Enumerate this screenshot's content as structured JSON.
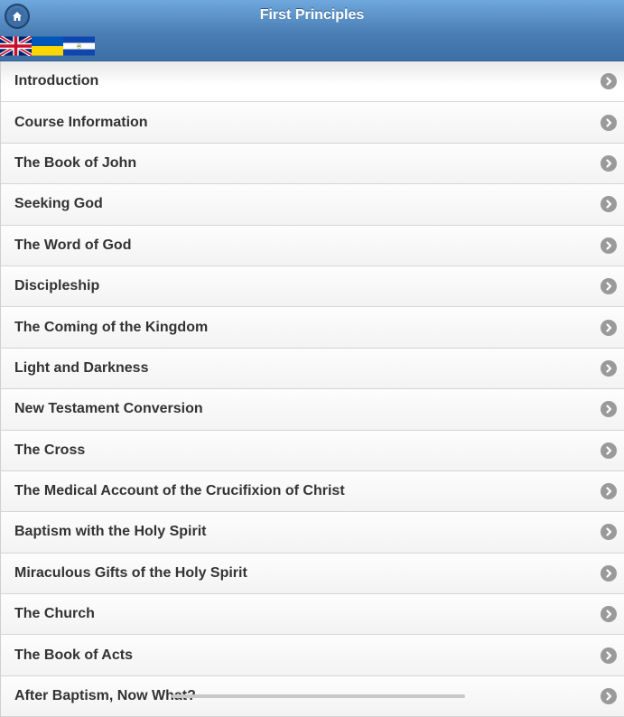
{
  "header": {
    "title": "First Principles",
    "home_icon": "home-icon"
  },
  "flags": [
    {
      "name": "uk-flag-icon"
    },
    {
      "name": "ukraine-flag-icon"
    },
    {
      "name": "el-salvador-flag-icon"
    }
  ],
  "list": {
    "items": [
      {
        "label": "Introduction"
      },
      {
        "label": "Course Information"
      },
      {
        "label": "The Book of John"
      },
      {
        "label": "Seeking God"
      },
      {
        "label": "The Word of God"
      },
      {
        "label": "Discipleship"
      },
      {
        "label": "The Coming of the Kingdom"
      },
      {
        "label": "Light and Darkness"
      },
      {
        "label": "New Testament Conversion"
      },
      {
        "label": "The Cross"
      },
      {
        "label": "The Medical Account of the Crucifixion of Christ"
      },
      {
        "label": "Baptism with the Holy Spirit"
      },
      {
        "label": "Miraculous Gifts of the Holy Spirit"
      },
      {
        "label": "The Church"
      },
      {
        "label": "The Book of Acts"
      },
      {
        "label": "After Baptism, Now What?"
      }
    ],
    "arrow_icon": "chevron-right-icon"
  },
  "colors": {
    "header_top": "#6fa8dc",
    "header_bottom": "#3d6fa6",
    "item_text": "#333333",
    "chevron_bg": "#9a9a9a"
  }
}
